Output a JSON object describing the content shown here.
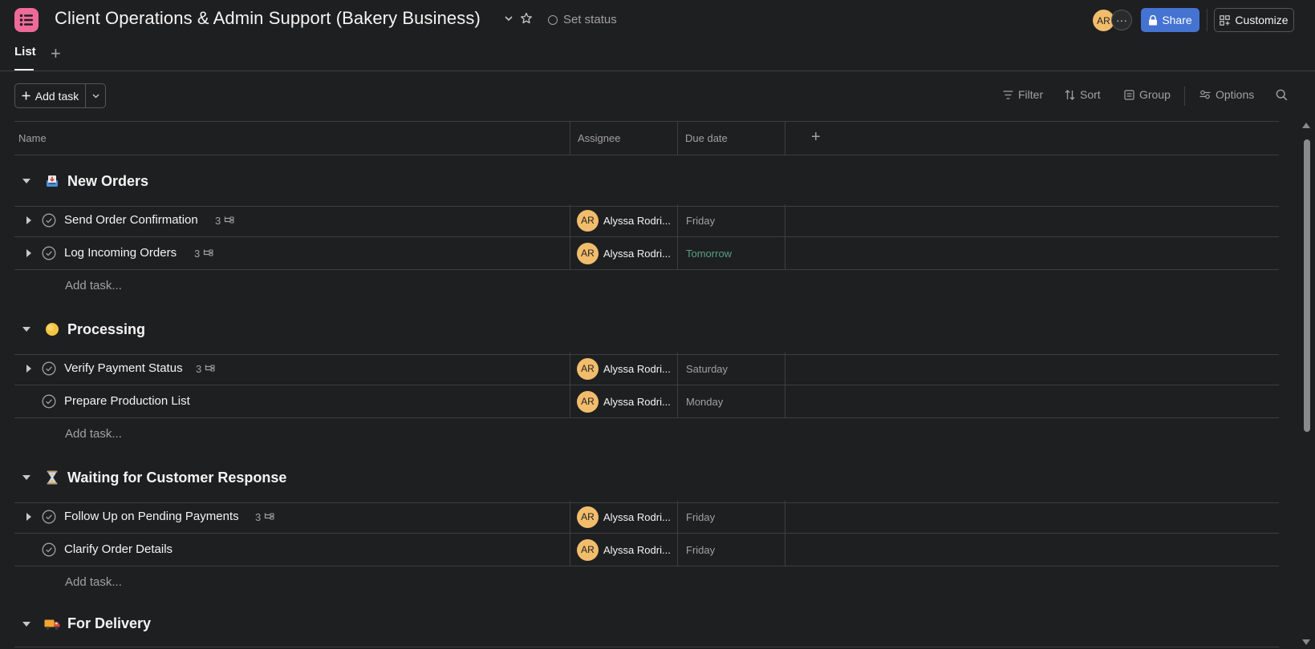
{
  "header": {
    "project_title": "Client Operations & Admin Support (Bakery Business)",
    "set_status_label": "Set status",
    "avatar_initials": "AR",
    "more_members": "···",
    "share_label": "Share",
    "customize_label": "Customize",
    "app_color": "#f06a99"
  },
  "tabs": {
    "active_label": "List",
    "add_tab": "+"
  },
  "toolbar": {
    "add_task_label": "Add task",
    "filter_label": "Filter",
    "sort_label": "Sort",
    "group_label": "Group",
    "options_label": "Options"
  },
  "columns": {
    "name": "Name",
    "assignee": "Assignee",
    "due_date": "Due date",
    "add_column": "+"
  },
  "sections": [
    {
      "title": "New Orders",
      "icon": "inbox-tray-icon",
      "tasks": [
        {
          "name": "Send Order Confirmation",
          "subtasks": "3",
          "assignee_initials": "AR",
          "assignee": "Alyssa Rodri...",
          "due": "Friday"
        },
        {
          "name": "Log Incoming Orders",
          "subtasks": "3",
          "assignee_initials": "AR",
          "assignee": "Alyssa Rodri...",
          "due": "Tomorrow"
        }
      ],
      "add_task_label": "Add task..."
    },
    {
      "title": "Processing",
      "icon": "yellow-circle-icon",
      "tasks": [
        {
          "name": "Verify Payment Status",
          "subtasks": "3",
          "assignee_initials": "AR",
          "assignee": "Alyssa Rodri...",
          "due": "Saturday"
        },
        {
          "name": "Prepare Production List",
          "assignee_initials": "AR",
          "assignee": "Alyssa Rodri...",
          "due": "Monday"
        }
      ],
      "add_task_label": "Add task..."
    },
    {
      "title": "Waiting for Customer Response",
      "icon": "hourglass-icon",
      "tasks": [
        {
          "name": "Follow Up on Pending Payments",
          "subtasks": "3",
          "assignee_initials": "AR",
          "assignee": "Alyssa Rodri...",
          "due": "Friday"
        },
        {
          "name": "Clarify Order Details",
          "assignee_initials": "AR",
          "assignee": "Alyssa Rodri...",
          "due": "Friday"
        }
      ],
      "add_task_label": "Add task..."
    },
    {
      "title": "For Delivery",
      "icon": "delivery-truck-icon"
    }
  ],
  "colors": {
    "background": "#1e1f21",
    "accent_blue": "#4573d2",
    "avatar": "#f1bd6c",
    "due_soon": "#58a182"
  }
}
